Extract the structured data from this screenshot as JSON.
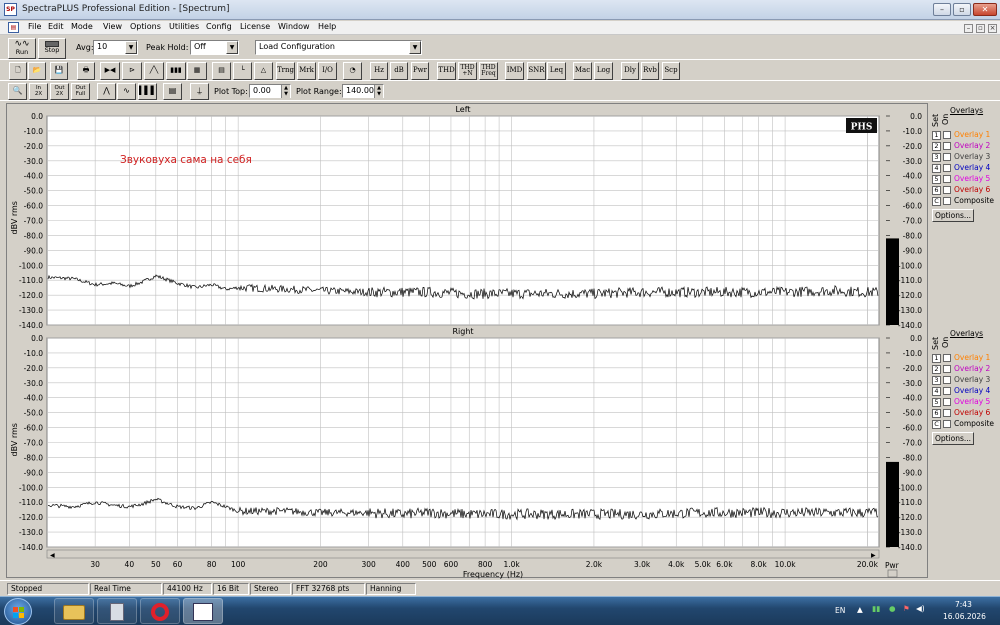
{
  "window": {
    "title": "SpectraPLUS Professional Edition - [Spectrum]"
  },
  "menu": [
    "File",
    "Edit",
    "Mode",
    "View",
    "Options",
    "Utilities",
    "Config",
    "License",
    "Window",
    "Help"
  ],
  "toolbar1": {
    "run": "Run",
    "stop": "Stop",
    "avg_label": "Avg:",
    "avg_value": "10",
    "peak_label": "Peak Hold:",
    "peak_value": "Off",
    "config_value": "Load Configuration"
  },
  "toolbar2": [
    {
      "name": "new-icon",
      "text": "🗋"
    },
    {
      "name": "open-icon",
      "text": "📂"
    },
    {
      "name": "save-icon",
      "text": "💾"
    },
    {
      "name": "print-icon",
      "text": "🖶"
    },
    {
      "name": "siggen-icon",
      "text": "▶◀"
    },
    {
      "name": "signal-icon",
      "text": "⊳"
    },
    {
      "name": "sweep-icon",
      "text": "╱╲"
    },
    {
      "name": "spectrogram-icon",
      "text": "▮▮▮"
    },
    {
      "name": "3d-icon",
      "text": "▦"
    },
    {
      "name": "time-view-icon",
      "text": "▤"
    },
    {
      "name": "axis-icon",
      "text": "└"
    },
    {
      "name": "weighting-icon",
      "text": "△"
    },
    {
      "name": "Trng",
      "text": "Trng"
    },
    {
      "name": "Mrk",
      "text": "Mrk"
    },
    {
      "name": "I/O",
      "text": "I/O"
    },
    {
      "name": "meter-icon",
      "text": "◔"
    },
    {
      "name": "Hz",
      "text": "Hz"
    },
    {
      "name": "dB",
      "text": "dB"
    },
    {
      "name": "Pwr",
      "text": "Pwr"
    },
    {
      "name": "THD",
      "text": "THD"
    },
    {
      "name": "THD+N",
      "text": "THD\n+N"
    },
    {
      "name": "THD Freq",
      "text": "THD\nFreq"
    },
    {
      "name": "IMD",
      "text": "IMD"
    },
    {
      "name": "SNR",
      "text": "SNR"
    },
    {
      "name": "Leq",
      "text": "Leq"
    },
    {
      "name": "Mac",
      "text": "Mac"
    },
    {
      "name": "Log",
      "text": "Log"
    },
    {
      "name": "Dly",
      "text": "Dly"
    },
    {
      "name": "Rvb",
      "text": "Rvb"
    },
    {
      "name": "Scp",
      "text": "Scp"
    }
  ],
  "toolbar3": {
    "buttons": [
      {
        "name": "zoom-icon",
        "text": "🔍"
      },
      {
        "name": "in-x-icon",
        "text": "In\n2X"
      },
      {
        "name": "out-2x-icon",
        "text": "Out\n2X"
      },
      {
        "name": "out-full-icon",
        "text": "Out\nFull"
      },
      {
        "name": "peak-icon",
        "text": "⋀"
      },
      {
        "name": "curve-icon",
        "text": "∿"
      },
      {
        "name": "bars-icon",
        "text": "▌▌▌"
      },
      {
        "name": "panel-icon",
        "text": "▤"
      },
      {
        "name": "marker-icon",
        "text": "⍊"
      }
    ],
    "plot_top_label": "Plot Top:",
    "plot_top_value": "0.00",
    "plot_range_label": "Plot Range:",
    "plot_range_value": "140.00"
  },
  "charts": [
    {
      "title": "Left",
      "ylabel": "dBV rms",
      "annotation": "Звуковуха сама на себя",
      "logo": "PHS",
      "yticks": [
        "0.0",
        "-10.0",
        "-20.0",
        "-30.0",
        "-40.0",
        "-50.0",
        "-60.0",
        "-70.0",
        "-80.0",
        "-90.0",
        "-100.0",
        "-110.0",
        "-120.0",
        "-130.0",
        "-140.0"
      ],
      "rticks": [
        "0.0",
        "-10.0",
        "-20.0",
        "-30.0",
        "-40.0",
        "-50.0",
        "-60.0",
        "-70.0",
        "-80.0",
        "-90.0",
        "-100.0",
        "-110.0",
        "-120.0",
        "-130.0",
        "-140.0"
      ]
    },
    {
      "title": "Right",
      "ylabel": "dBV rms",
      "yticks": [
        "0.0",
        "-10.0",
        "-20.0",
        "-30.0",
        "-40.0",
        "-50.0",
        "-60.0",
        "-70.0",
        "-80.0",
        "-90.0",
        "-100.0",
        "-110.0",
        "-120.0",
        "-130.0",
        "-140.0"
      ],
      "rticks": [
        "0.0",
        "-10.0",
        "-20.0",
        "-30.0",
        "-40.0",
        "-50.0",
        "-60.0",
        "-70.0",
        "-80.0",
        "-90.0",
        "-100.0",
        "-110.0",
        "-120.0",
        "-130.0",
        "-140.0"
      ]
    }
  ],
  "chart_data": [
    {
      "type": "line",
      "title": "Left",
      "xlabel": "Frequency (Hz)",
      "ylabel": "dBV rms",
      "xscale": "log",
      "xlim": [
        20,
        22050
      ],
      "ylim": [
        -140,
        0
      ],
      "grid": true,
      "series": [
        {
          "x": [
            20,
            25,
            30,
            35,
            40,
            45,
            50,
            60,
            70,
            80,
            90,
            100,
            150,
            200,
            300,
            400,
            500,
            700,
            1000,
            2000,
            3000,
            5000,
            10000,
            15000,
            20000
          ],
          "y": [
            -108,
            -109,
            -113,
            -112,
            -114,
            -111,
            -107,
            -112,
            -115,
            -113,
            -116,
            -115,
            -116,
            -117,
            -118,
            -118,
            -118,
            -119,
            -119,
            -119,
            -118,
            -118,
            -118,
            -117,
            -118
          ]
        }
      ]
    },
    {
      "type": "line",
      "title": "Right",
      "xlabel": "Frequency (Hz)",
      "ylabel": "dBV rms",
      "xscale": "log",
      "xlim": [
        20,
        22050
      ],
      "ylim": [
        -140,
        0
      ],
      "grid": true,
      "series": [
        {
          "x": [
            20,
            25,
            30,
            35,
            40,
            45,
            50,
            60,
            70,
            80,
            90,
            100,
            150,
            200,
            300,
            400,
            500,
            700,
            1000,
            2000,
            3000,
            5000,
            10000,
            15000,
            20000
          ],
          "y": [
            -112,
            -113,
            -110,
            -112,
            -113,
            -111,
            -108,
            -113,
            -114,
            -110,
            -113,
            -116,
            -116,
            -117,
            -117,
            -118,
            -117,
            -118,
            -118,
            -118,
            -118,
            -117,
            -117,
            -117,
            -117
          ]
        }
      ]
    }
  ],
  "xaxis": {
    "ticks": [
      {
        "v": 30,
        "t": "30"
      },
      {
        "v": 40,
        "t": "40"
      },
      {
        "v": 50,
        "t": "50"
      },
      {
        "v": 60,
        "t": "60"
      },
      {
        "v": 80,
        "t": "80"
      },
      {
        "v": 100,
        "t": "100"
      },
      {
        "v": 200,
        "t": "200"
      },
      {
        "v": 300,
        "t": "300"
      },
      {
        "v": 400,
        "t": "400"
      },
      {
        "v": 500,
        "t": "500"
      },
      {
        "v": 600,
        "t": "600"
      },
      {
        "v": 800,
        "t": "800"
      },
      {
        "v": 1000,
        "t": "1.0k"
      },
      {
        "v": 2000,
        "t": "2.0k"
      },
      {
        "v": 3000,
        "t": "3.0k"
      },
      {
        "v": 4000,
        "t": "4.0k"
      },
      {
        "v": 5000,
        "t": "5.0k"
      },
      {
        "v": 6000,
        "t": "6.0k"
      },
      {
        "v": 8000,
        "t": "8.0k"
      },
      {
        "v": 10000,
        "t": "10.0k"
      },
      {
        "v": 20000,
        "t": "20.0k"
      }
    ],
    "label": "Frequency (Hz)",
    "pwr": "Pwr"
  },
  "overlays": {
    "title": "Overlays",
    "set": "Set",
    "on": "On",
    "items": [
      {
        "n": "1",
        "label": "Overlay 1",
        "color": "#ff8000"
      },
      {
        "n": "2",
        "label": "Overlay 2",
        "color": "#c000c0"
      },
      {
        "n": "3",
        "label": "Overlay 3",
        "color": "#404040"
      },
      {
        "n": "4",
        "label": "Overlay 4",
        "color": "#0000c0"
      },
      {
        "n": "5",
        "label": "Overlay 5",
        "color": "#e000e0"
      },
      {
        "n": "6",
        "label": "Overlay 6",
        "color": "#c00000"
      }
    ],
    "composite_n": "C",
    "composite": "Composite",
    "options": "Options..."
  },
  "rightbar_levels": [
    -82,
    -83
  ],
  "status": [
    "Stopped",
    "Real Time",
    "44100 Hz",
    "16 Bit",
    "Stereo",
    "FFT 32768 pts",
    "Hanning"
  ],
  "taskbar": {
    "lang": "EN",
    "time": "7:43",
    "date": "16.06.2026"
  },
  "colors": {
    "trace": "#000000",
    "grid": "#c0c0c0",
    "annotation": "#d02020",
    "overlay_panel": "#d4d0c8"
  }
}
